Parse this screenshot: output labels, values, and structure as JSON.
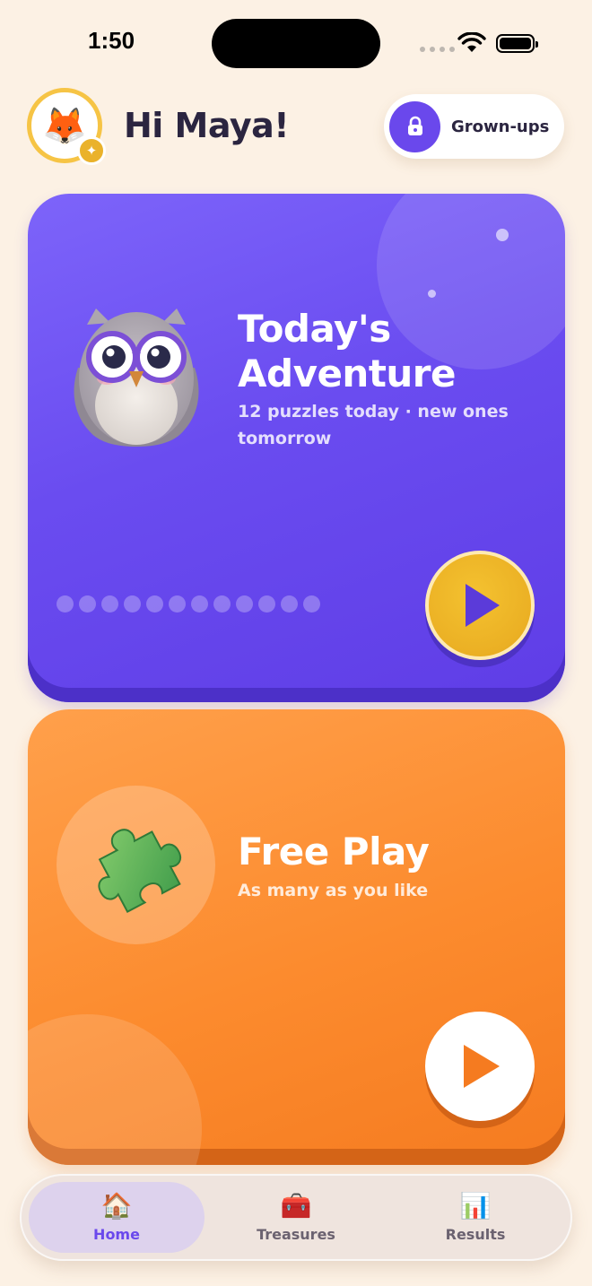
{
  "status_bar": {
    "time": "1:50"
  },
  "header": {
    "avatar_emoji": "🦊",
    "badge_icon": "sparkle-icon",
    "greeting": "Hi Maya!",
    "grownups_label": "Grown-ups"
  },
  "adventure_card": {
    "title_line1": "Today's",
    "title_line2": "Adventure",
    "subtitle_line1": "12 puzzles today · new ones",
    "subtitle_line2": "tomorrow",
    "puzzle_count": 12,
    "completed": 0,
    "mascot": "owl-icon"
  },
  "freeplay_card": {
    "title": "Free Play",
    "subtitle": "As many as you like",
    "icon": "puzzle-piece-icon"
  },
  "tabs": [
    {
      "label": "Home",
      "icon": "🏠",
      "active": true
    },
    {
      "label": "Treasures",
      "icon": "🧰",
      "active": false
    },
    {
      "label": "Results",
      "icon": "📊",
      "active": false
    }
  ],
  "colors": {
    "background": "#fcf1e4",
    "adventure": "#6a4cf0",
    "freeplay": "#fc8b2e",
    "accent": "#6a48ec",
    "gold": "#ebb024"
  }
}
